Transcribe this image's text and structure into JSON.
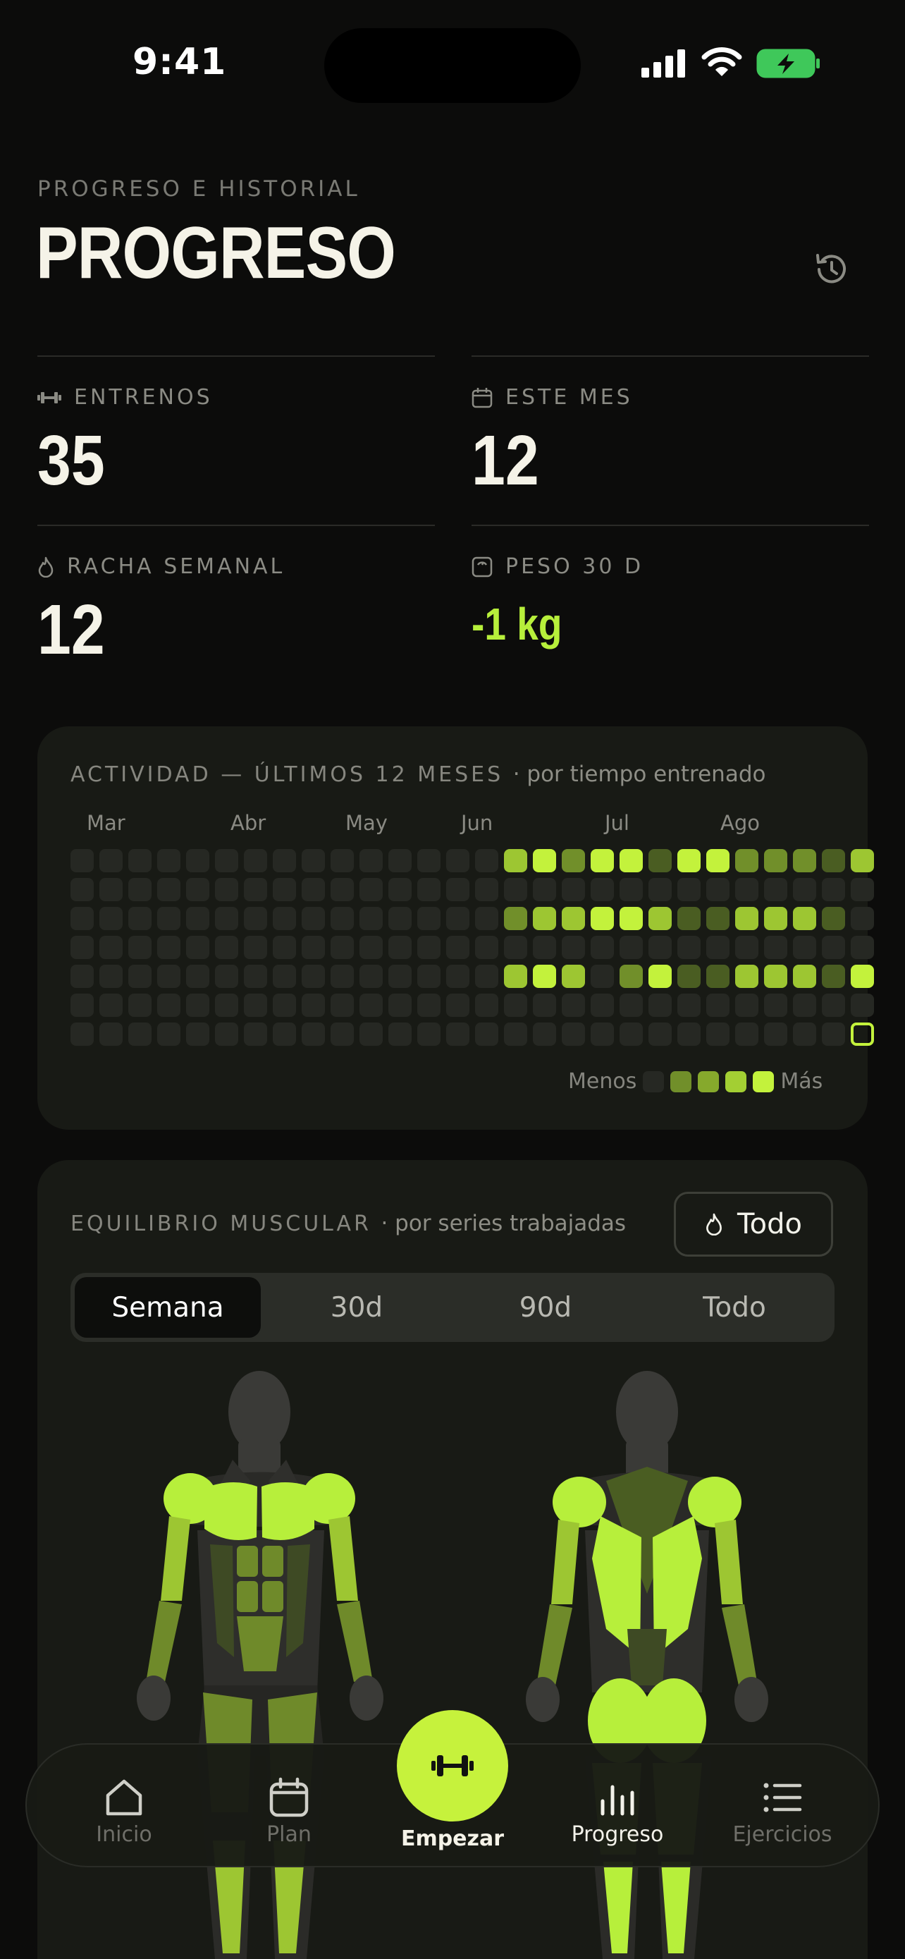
{
  "status_bar": {
    "time": "9:41"
  },
  "header": {
    "eyebrow": "PROGRESO E HISTORIAL",
    "title": "PROGRESO"
  },
  "stats": [
    {
      "label": "ENTRENOS",
      "value": "35",
      "icon": "dumbbell-icon"
    },
    {
      "label": "ESTE MES",
      "value": "12",
      "icon": "calendar-icon"
    },
    {
      "label": "RACHA SEMANAL",
      "value": "12",
      "icon": "flame-icon"
    },
    {
      "label": "PESO 30 D",
      "value": "-1 kg",
      "icon": "scale-icon"
    }
  ],
  "activity": {
    "title": "ACTIVIDAD — ÚLTIMOS 12 MESES",
    "subtitle": "· por tiempo entrenado",
    "months": [
      "Mar",
      "Abr",
      "May",
      "Jun",
      "Jul",
      "Ago"
    ],
    "legend_less": "Menos",
    "legend_more": "Más",
    "levels_by_row": [
      [
        0,
        0,
        0,
        0,
        0,
        0,
        0,
        0,
        0,
        0,
        0,
        0,
        0,
        0,
        0,
        3,
        4,
        2,
        4,
        4,
        1,
        4,
        4,
        2,
        2,
        2,
        1,
        3
      ],
      [
        0,
        0,
        0,
        0,
        0,
        0,
        0,
        0,
        0,
        0,
        0,
        0,
        0,
        0,
        0,
        0,
        0,
        0,
        0,
        0,
        0,
        0,
        0,
        0,
        0,
        0,
        0,
        0
      ],
      [
        0,
        0,
        0,
        0,
        0,
        0,
        0,
        0,
        0,
        0,
        0,
        0,
        0,
        0,
        0,
        2,
        3,
        3,
        4,
        4,
        3,
        1,
        1,
        3,
        3,
        3,
        1,
        0
      ],
      [
        0,
        0,
        0,
        0,
        0,
        0,
        0,
        0,
        0,
        0,
        0,
        0,
        0,
        0,
        0,
        0,
        0,
        0,
        0,
        0,
        0,
        0,
        0,
        0,
        0,
        0,
        0,
        0
      ],
      [
        0,
        0,
        0,
        0,
        0,
        0,
        0,
        0,
        0,
        0,
        0,
        0,
        0,
        0,
        0,
        3,
        4,
        3,
        0,
        2,
        4,
        1,
        1,
        3,
        3,
        3,
        1,
        4
      ],
      [
        0,
        0,
        0,
        0,
        0,
        0,
        0,
        0,
        0,
        0,
        0,
        0,
        0,
        0,
        0,
        0,
        0,
        0,
        0,
        0,
        0,
        0,
        0,
        0,
        0,
        0,
        0,
        0
      ],
      [
        0,
        0,
        0,
        0,
        0,
        0,
        0,
        0,
        0,
        0,
        0,
        0,
        0,
        0,
        0,
        0,
        0,
        0,
        0,
        0,
        0,
        0,
        0,
        0,
        0,
        0,
        0,
        5
      ]
    ],
    "colors": [
      "#262823",
      "#4a5d22",
      "#718f2a",
      "#9dc632",
      "#c3f23c"
    ]
  },
  "muscle_balance": {
    "title": "EQUILIBRIO MUSCULAR",
    "subtitle": "· por series trabajadas",
    "filter_label": "Todo",
    "tabs": [
      "Semana",
      "30d",
      "90d",
      "Todo"
    ],
    "active_tab": "Semana"
  },
  "nav": {
    "items": [
      {
        "label": "Inicio",
        "icon": "home-icon"
      },
      {
        "label": "Plan",
        "icon": "calendar-icon"
      },
      {
        "label": "Empezar",
        "icon": "dumbbell-icon"
      },
      {
        "label": "Progreso",
        "icon": "bar-chart-icon"
      },
      {
        "label": "Ejercicios",
        "icon": "list-icon"
      }
    ],
    "active": "Progreso"
  },
  "colors": {
    "accent": "#c3f23c",
    "background": "#0c0c0b",
    "card": "#181a15"
  }
}
